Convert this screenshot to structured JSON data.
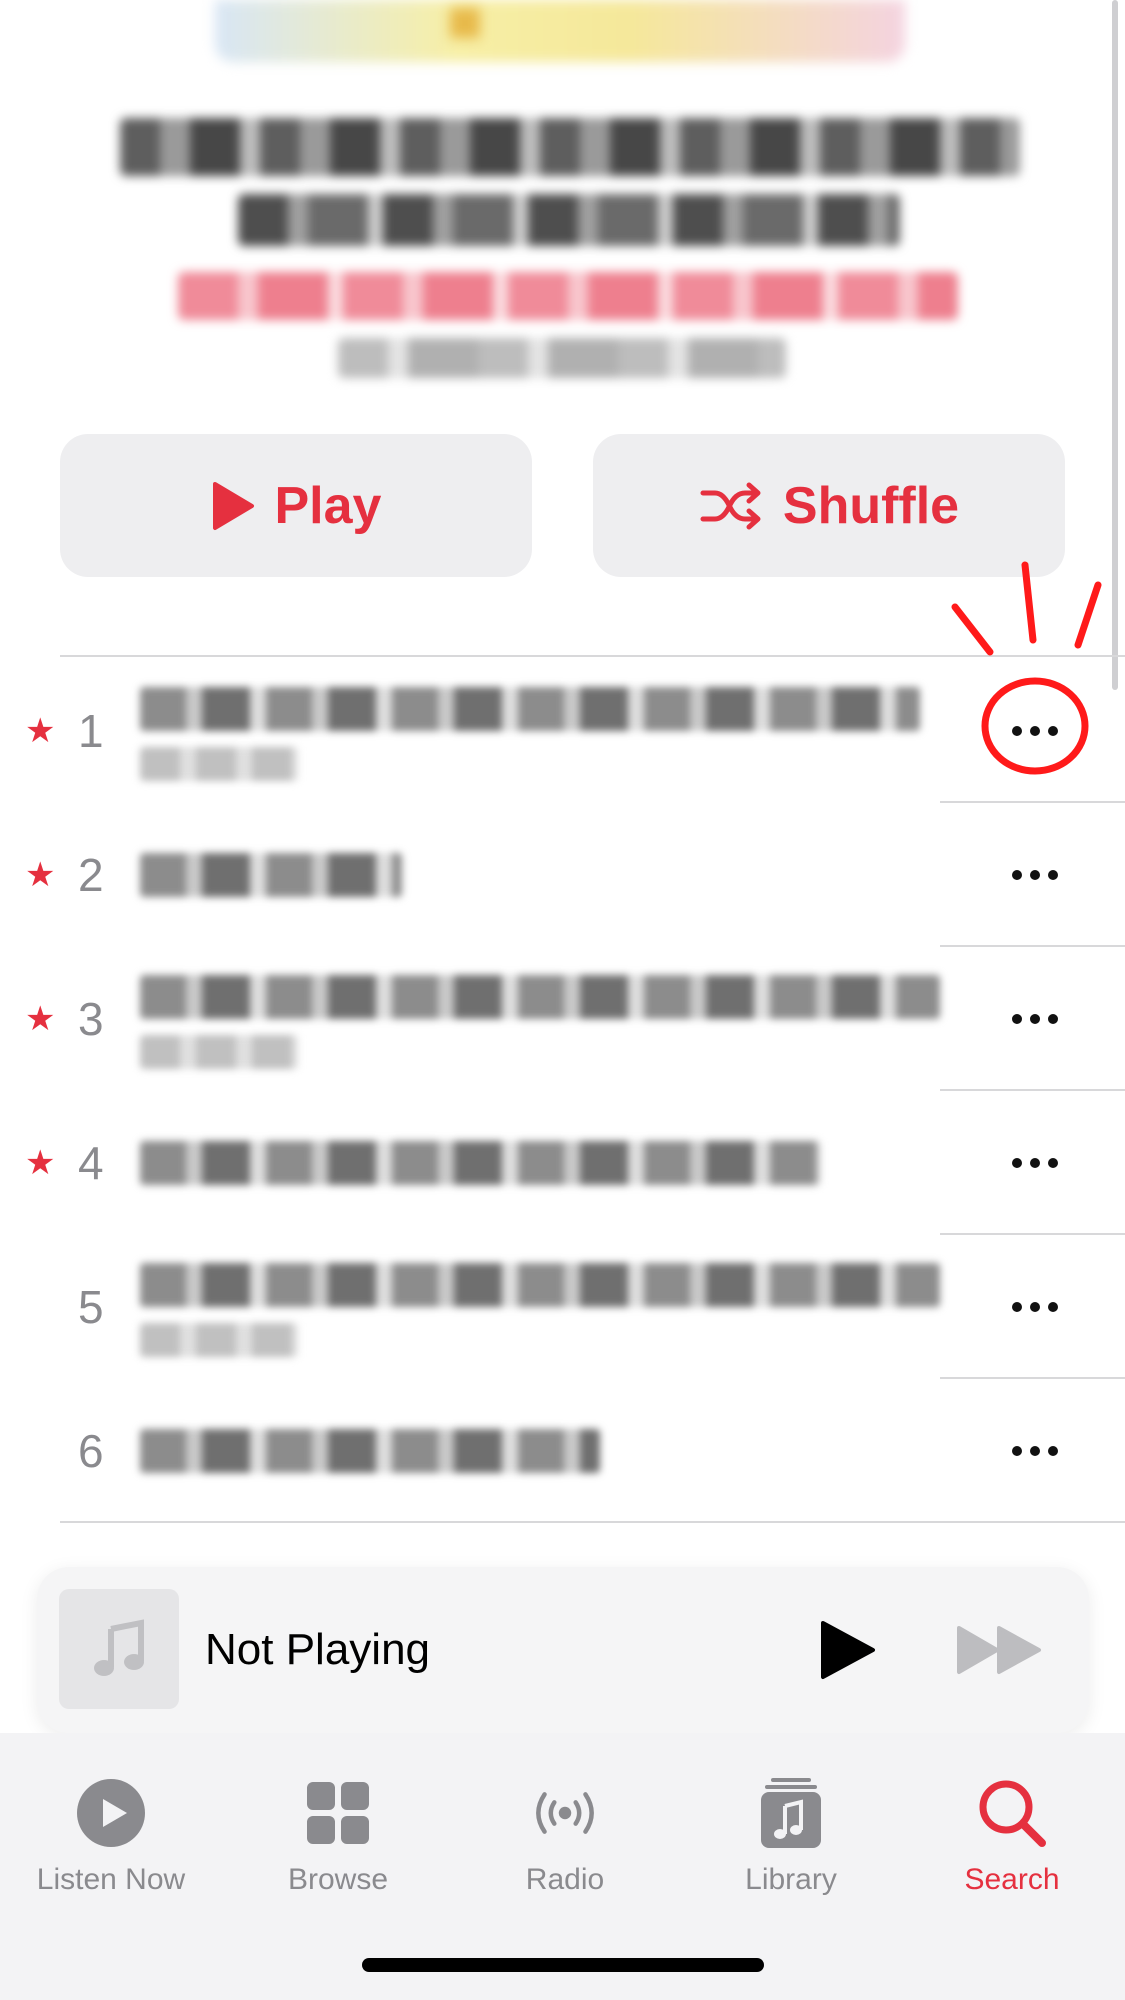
{
  "album": {
    "play_label": "Play",
    "shuffle_label": "Shuffle"
  },
  "tracks": [
    {
      "number": "1",
      "favorite": true
    },
    {
      "number": "2",
      "favorite": true
    },
    {
      "number": "3",
      "favorite": true
    },
    {
      "number": "4",
      "favorite": true
    },
    {
      "number": "5",
      "favorite": false
    },
    {
      "number": "6",
      "favorite": false
    }
  ],
  "mini_player": {
    "status": "Not Playing"
  },
  "tabs": [
    {
      "label": "Listen Now",
      "icon": "listen-now-icon",
      "active": false
    },
    {
      "label": "Browse",
      "icon": "browse-icon",
      "active": false
    },
    {
      "label": "Radio",
      "icon": "radio-icon",
      "active": false
    },
    {
      "label": "Library",
      "icon": "library-icon",
      "active": false
    },
    {
      "label": "Search",
      "icon": "search-icon",
      "active": true
    }
  ],
  "colors": {
    "accent": "#e5303f",
    "inactive": "#8a8a8e",
    "annotation": "#ff1a1a"
  }
}
